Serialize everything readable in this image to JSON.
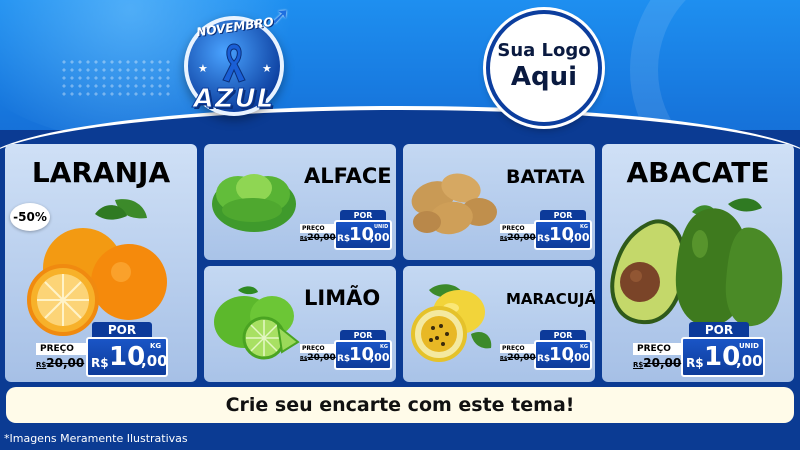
{
  "header": {
    "badge_top": "NOVEMBRO",
    "badge_bottom": "AZUL",
    "logo_line1": "Sua Logo",
    "logo_line2": "Aqui"
  },
  "products": [
    {
      "name": "LARANJA",
      "discount": "-50%",
      "por_label": "POR",
      "preco_label": "PREÇO",
      "old_currency": "R$",
      "old_price": "20,00",
      "currency": "R$",
      "price_int": "10",
      "price_cents": ",00",
      "unit": "KG"
    },
    {
      "name": "ALFACE",
      "por_label": "POR",
      "preco_label": "PREÇO",
      "old_currency": "R$",
      "old_price": "20,00",
      "currency": "R$",
      "price_int": "10",
      "price_cents": ",00",
      "unit": "UNID"
    },
    {
      "name": "BATATA",
      "por_label": "POR",
      "preco_label": "PREÇO",
      "old_currency": "R$",
      "old_price": "20,00",
      "currency": "R$",
      "price_int": "10",
      "price_cents": ",00",
      "unit": "KG"
    },
    {
      "name": "LIMÃO",
      "por_label": "POR",
      "preco_label": "PREÇO",
      "old_currency": "R$",
      "old_price": "20,00",
      "currency": "R$",
      "price_int": "10",
      "price_cents": ",00",
      "unit": "KG"
    },
    {
      "name": "MARACUJÁ",
      "por_label": "POR",
      "preco_label": "PREÇO",
      "old_currency": "R$",
      "old_price": "20,00",
      "currency": "R$",
      "price_int": "10",
      "price_cents": ",00",
      "unit": "KG"
    },
    {
      "name": "ABACATE",
      "por_label": "POR",
      "preco_label": "PREÇO",
      "old_currency": "R$",
      "old_price": "20,00",
      "currency": "R$",
      "price_int": "10",
      "price_cents": ",00",
      "unit": "UNID"
    }
  ],
  "banner": "Crie seu encarte com este tema!",
  "footnote": "*Imagens Meramente Ilustrativas",
  "colors": {
    "brand_blue": "#0c3a9a",
    "sky_blue": "#1e8ff0",
    "card_bg": "#b9cfee",
    "banner_bg": "#fffbe9"
  }
}
